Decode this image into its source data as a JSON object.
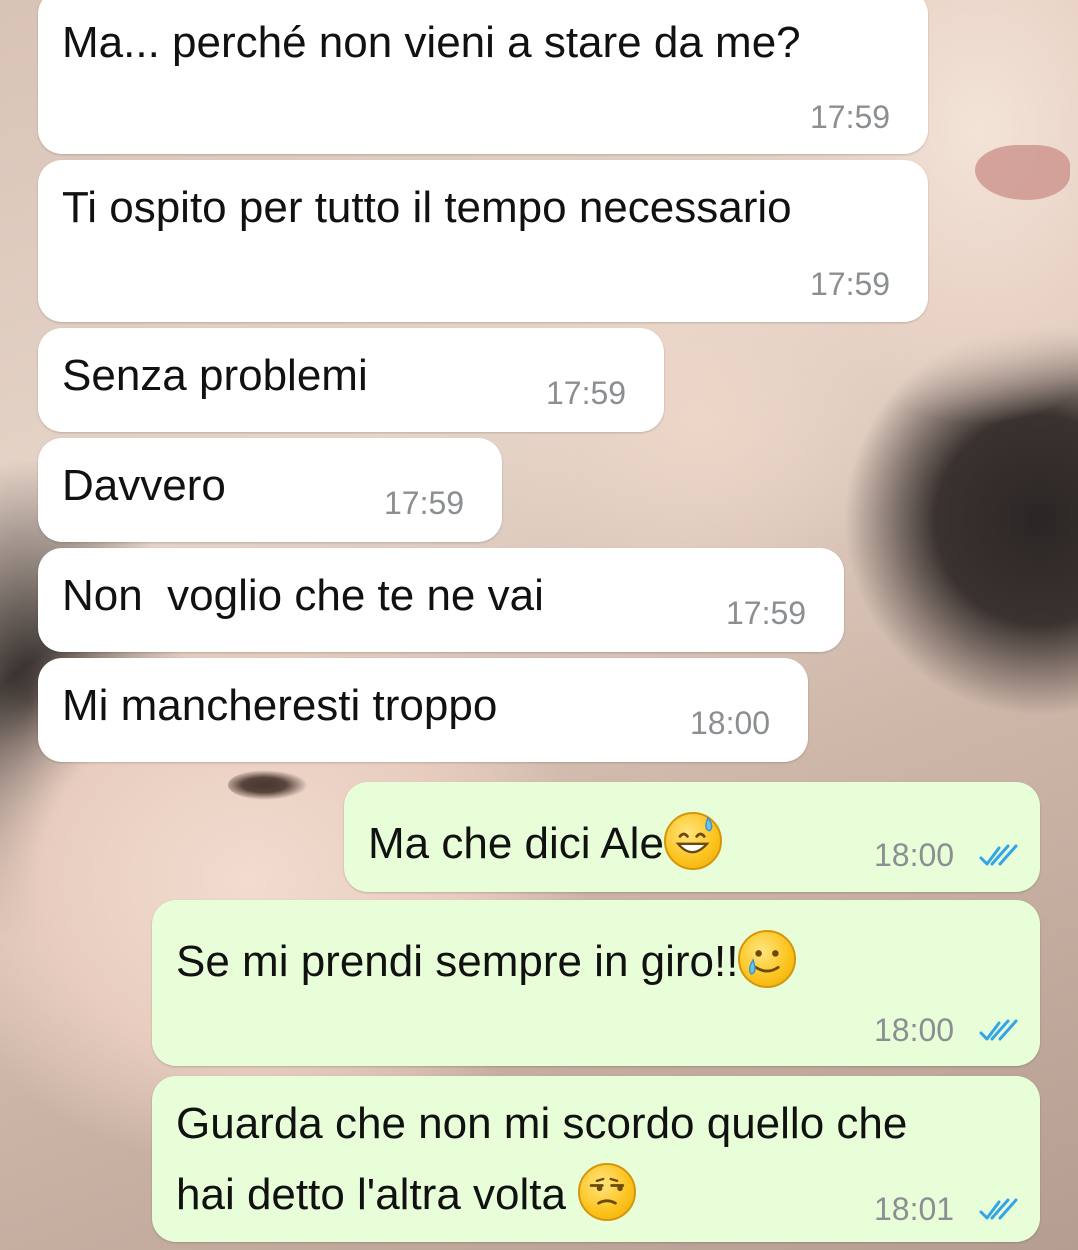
{
  "chat": {
    "messages": [
      {
        "direction": "incoming",
        "text": "Ma... perché non vieni a stare da me?",
        "time": "17:59"
      },
      {
        "direction": "incoming",
        "text": "Ti ospito per tutto il tempo necessario",
        "time": "17:59"
      },
      {
        "direction": "incoming",
        "text": "Senza problemi",
        "time": "17:59"
      },
      {
        "direction": "incoming",
        "text": "Davvero",
        "time": "17:59"
      },
      {
        "direction": "incoming",
        "text": "Non  voglio che te ne vai",
        "time": "17:59"
      },
      {
        "direction": "incoming",
        "text": "Mi mancheresti troppo",
        "time": "18:00"
      },
      {
        "direction": "outgoing",
        "text": "Ma che dici Ale",
        "emoji": "grinning-sweat-emoji",
        "time": "18:00",
        "status": "read"
      },
      {
        "direction": "outgoing",
        "text": "Se mi prendi sempre in giro!!",
        "emoji": "smiling-tear-emoji",
        "time": "18:00",
        "status": "read"
      },
      {
        "direction": "outgoing",
        "text_line1": "Guarda che non mi scordo quello che",
        "text_line2": "hai detto l'altra volta",
        "emoji": "unamused-emoji",
        "time": "18:01",
        "status": "read"
      }
    ]
  },
  "colors": {
    "incoming_bubble": "#ffffff",
    "outgoing_bubble": "#e7fed8",
    "timestamp": "#8b8f92",
    "read_check": "#34a4e6"
  }
}
